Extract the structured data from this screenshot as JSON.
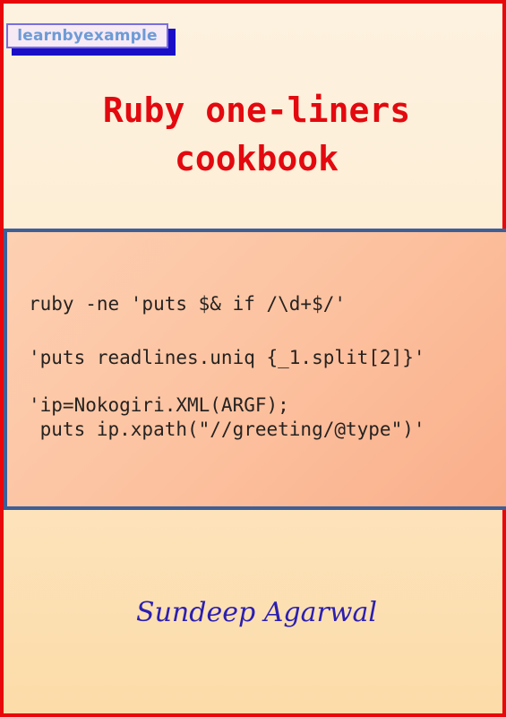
{
  "badge": {
    "label": "learnbyexample"
  },
  "title": {
    "line1": "Ruby one-liners",
    "line2": "cookbook"
  },
  "code_examples": [
    "ruby -ne 'puts $& if /\\d+$/'",
    "'puts readlines.uniq {_1.split[2]}'",
    "'ip=Nokogiri.XML(ARGF);\n puts ip.xpath(\"//greeting/@type\")'"
  ],
  "author": "Sundeep Agarwal",
  "colors": {
    "outer_border": "#e8070b",
    "title": "#e3090f",
    "panel_border": "#3e5f96",
    "author": "#2b1fb0",
    "badge_text": "#6d9bd6",
    "badge_shadow": "#1a0fc6"
  }
}
